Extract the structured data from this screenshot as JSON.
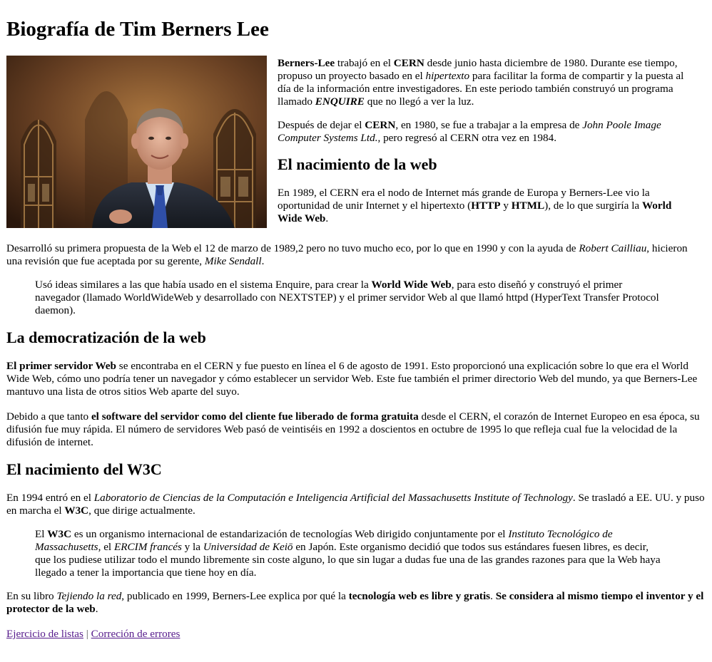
{
  "title": "Biografía de Tim Berners Lee",
  "image": {
    "alt": "Tim Berners-Lee"
  },
  "intro": {
    "p1": [
      {
        "t": "Berners-Lee",
        "s": "b"
      },
      {
        "t": " trabajó en el "
      },
      {
        "t": "CERN",
        "s": "b"
      },
      {
        "t": " desde junio hasta diciembre de 1980. Durante ese tiempo, propuso un proyecto basado en el "
      },
      {
        "t": "hipertexto",
        "s": "i"
      },
      {
        "t": " para facilitar la forma de compartir y la puesta al día de la información entre investigadores. En este periodo también construyó un programa llamado "
      },
      {
        "t": "ENQUIRE",
        "s": "bi"
      },
      {
        "t": " que no llegó a ver la luz."
      }
    ],
    "p2": [
      {
        "t": "Después de dejar el "
      },
      {
        "t": "CERN",
        "s": "b"
      },
      {
        "t": ", en 1980, se fue a trabajar a la empresa de "
      },
      {
        "t": "John Poole Image Computer Systems Ltd.",
        "s": "i"
      },
      {
        "t": ", pero regresó al CERN otra vez en 1984."
      }
    ]
  },
  "section1": {
    "heading": "El nacimiento de la web",
    "p1": [
      {
        "t": "En 1989, el CERN era el nodo de Internet más grande de Europa y Berners-Lee vio la oportunidad de unir Internet y el hipertexto ("
      },
      {
        "t": "HTTP",
        "s": "b"
      },
      {
        "t": " y "
      },
      {
        "t": "HTML",
        "s": "b"
      },
      {
        "t": "), de lo que surgiría la "
      },
      {
        "t": "World Wide Web",
        "s": "b"
      },
      {
        "t": "."
      }
    ],
    "p2": [
      {
        "t": "Desarrolló su primera propuesta de la Web el 12 de marzo de 1989,2 pero no tuvo mucho eco, por lo que en 1990 y con la ayuda de "
      },
      {
        "t": "Robert Cailliau",
        "s": "i"
      },
      {
        "t": ", hicieron una revisión que fue aceptada por su gerente, "
      },
      {
        "t": "Mike Sendall",
        "s": "i"
      },
      {
        "t": "."
      }
    ],
    "quote": [
      {
        "t": "Usó ideas similares a las que había usado en el sistema Enquire, para crear la "
      },
      {
        "t": "World Wide Web",
        "s": "b"
      },
      {
        "t": ", para esto diseñó y construyó el primer navegador (llamado WorldWideWeb y desarrollado con NEXTSTEP) y el primer servidor Web al que llamó httpd (HyperText Transfer Protocol daemon)."
      }
    ]
  },
  "section2": {
    "heading": "La democratización de la web",
    "p1": [
      {
        "t": "El primer servidor Web",
        "s": "b"
      },
      {
        "t": " se encontraba en el CERN y fue puesto en línea el 6 de agosto de 1991. Esto proporcionó una explicación sobre lo que era el World Wide Web, cómo uno podría tener un navegador y cómo establecer un servidor Web. Este fue también el primer directorio Web del mundo, ya que Berners-Lee mantuvo una lista de otros sitios Web aparte del suyo."
      }
    ],
    "p2": [
      {
        "t": "Debido a que tanto "
      },
      {
        "t": "el software del servidor como del cliente fue liberado de forma gratuita",
        "s": "b"
      },
      {
        "t": " desde el CERN, el corazón de Internet Europeo en esa época, su difusión fue muy rápida. El número de servidores Web pasó de veintiséis en 1992 a doscientos en octubre de 1995 lo que refleja cual fue la velocidad de la difusión de internet."
      }
    ]
  },
  "section3": {
    "heading": "El nacimiento del W3C",
    "p1": [
      {
        "t": "En 1994 entró en el "
      },
      {
        "t": "Laboratorio de Ciencias de la Computación e Inteligencia Artificial del Massachusetts Institute of Technology",
        "s": "i"
      },
      {
        "t": ". Se trasladó a EE. UU. y puso en marcha el "
      },
      {
        "t": "W3C",
        "s": "b"
      },
      {
        "t": ", que dirige actualmente."
      }
    ],
    "quote": [
      {
        "t": "El "
      },
      {
        "t": "W3C",
        "s": "b"
      },
      {
        "t": " es un organismo internacional de estandarización de tecnologías Web dirigido conjuntamente por el "
      },
      {
        "t": "Instituto Tecnológico de Massachusetts",
        "s": "i"
      },
      {
        "t": ", el "
      },
      {
        "t": "ERCIM francés",
        "s": "i"
      },
      {
        "t": " y la "
      },
      {
        "t": "Universidad de Keiō",
        "s": "i"
      },
      {
        "t": " en Japón. Este organismo decidió que todos sus estándares fuesen libres, es decir, que los pudiese utilizar todo el mundo libremente sin coste alguno, lo que sin lugar a dudas fue una de las grandes razones para que la Web haya llegado a tener la importancia que tiene hoy en día."
      }
    ],
    "p2": [
      {
        "t": "En su libro "
      },
      {
        "t": "Tejiendo la red",
        "s": "i"
      },
      {
        "t": ", publicado en 1999, Berners-Lee explica por qué la "
      },
      {
        "t": "tecnología web es libre y gratis",
        "s": "b"
      },
      {
        "t": ". "
      },
      {
        "t": "Se considera al mismo tiempo el inventor y el protector de la web",
        "s": "b"
      },
      {
        "t": "."
      }
    ]
  },
  "footer": {
    "link1": "Ejercicio de listas",
    "separator": "|",
    "link2": "Correción de errores"
  },
  "colors": {
    "link": "#551a8b",
    "text": "#000000",
    "background": "#ffffff"
  }
}
